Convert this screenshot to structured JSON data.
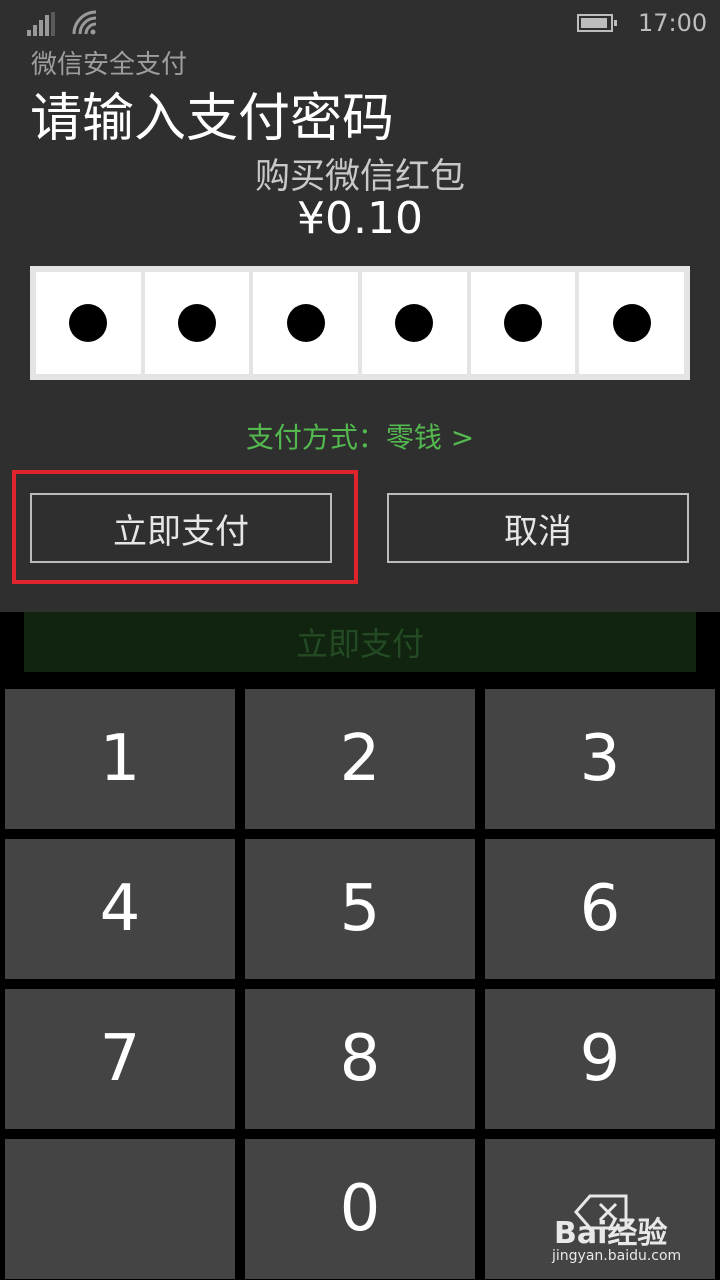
{
  "status_bar": {
    "time": "17:00"
  },
  "dialog": {
    "app_subtitle": "微信安全支付",
    "title": "请输入支付密码",
    "purchase_desc": "购买微信红包",
    "amount": "¥0.10",
    "pin_entered": 6,
    "pin_length": 6,
    "payment_method": "支付方式：零钱 >",
    "pay_button": "立即支付",
    "cancel_button": "取消"
  },
  "background_button": "立即支付",
  "keypad": {
    "keys": [
      "1",
      "2",
      "3",
      "4",
      "5",
      "6",
      "7",
      "8",
      "9",
      "",
      "0",
      "⌫"
    ]
  },
  "watermark": {
    "brand": "Bai经验",
    "url": "jingyan.baidu.com"
  },
  "colors": {
    "accent_green": "#53b94f",
    "highlight_red": "#e0242b"
  }
}
